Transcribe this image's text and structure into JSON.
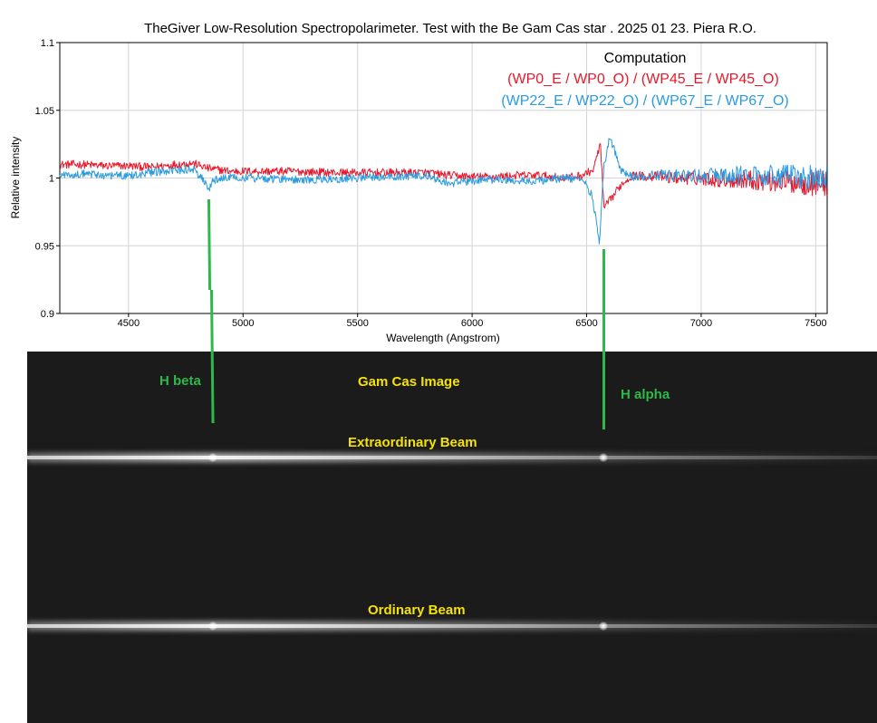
{
  "chart_data": {
    "type": "line",
    "title": "TheGiver Low-Resolution Spectropolarimeter. Test with the Be Gam Cas star . 2025 01 23. Piera R.O.",
    "xlabel": "Wavelength (Angstrom)",
    "ylabel": "Relative intensity",
    "xlim": [
      4200,
      7550
    ],
    "ylim": [
      0.9,
      1.1
    ],
    "x_ticks": [
      4500,
      5000,
      5500,
      6000,
      6500,
      7000,
      7500
    ],
    "y_ticks": [
      0.9,
      0.95,
      1,
      1.05,
      1.1
    ],
    "y_tick_labels": [
      "0.9",
      "0.95",
      "1",
      "1.05",
      "1.1"
    ],
    "legend": {
      "heading": "Computation",
      "placement": "top-right",
      "entries": [
        {
          "text": "(WP0_E / WP0_O) / (WP45_E  / WP45_O)",
          "color": "#e8182a"
        },
        {
          "text": "(WP22_E / WP22_O) / (WP67_E  / WP67_O)",
          "color": "#2a9be0"
        }
      ]
    },
    "series": [
      {
        "color": "#e8182a",
        "x": [
          4200,
          4300,
          4400,
          4500,
          4600,
          4700,
          4780,
          4850,
          4950,
          5050,
          5200,
          5400,
          5600,
          5800,
          5900,
          6000,
          6100,
          6200,
          6300,
          6400,
          6480,
          6530,
          6560,
          6575,
          6600,
          6650,
          6700,
          6800,
          6900,
          7000,
          7100,
          7200,
          7300,
          7400,
          7500,
          7550
        ],
        "y": [
          1.01,
          1.01,
          1.009,
          1.009,
          1.008,
          1.01,
          1.011,
          1.007,
          1.005,
          1.005,
          1.005,
          1.004,
          1.004,
          1.004,
          1.002,
          1.001,
          1.001,
          1.002,
          1.002,
          1.0,
          1.002,
          1.006,
          1.026,
          0.978,
          0.983,
          0.995,
          1.002,
          1.001,
          1.0,
          1.0,
          0.999,
          0.999,
          0.998,
          0.997,
          0.996,
          0.996
        ]
      },
      {
        "color": "#2a9be0",
        "x": [
          4200,
          4300,
          4400,
          4500,
          4600,
          4700,
          4780,
          4830,
          4850,
          4870,
          4950,
          5050,
          5200,
          5400,
          5600,
          5800,
          5900,
          6000,
          6100,
          6200,
          6300,
          6400,
          6480,
          6520,
          6540,
          6555,
          6575,
          6600,
          6650,
          6700,
          6800,
          6900,
          7000,
          7100,
          7200,
          7300,
          7400,
          7500,
          7550
        ],
        "y": [
          1.002,
          1.003,
          1.002,
          1.002,
          1.004,
          1.005,
          1.007,
          0.998,
          0.991,
          0.998,
          1.001,
          1.0,
          0.999,
          0.999,
          1.001,
          1.002,
          0.996,
          0.998,
          0.999,
          0.998,
          0.998,
          1.0,
          0.999,
          0.988,
          0.972,
          0.95,
          1.008,
          1.03,
          1.006,
          1.001,
          1.002,
          1.002,
          1.001,
          1.002,
          1.002,
          1.002,
          1.001,
          1.0,
          1.0
        ]
      }
    ]
  },
  "image_labels": {
    "center": "Gam Cas  Image",
    "h_beta": "H beta",
    "h_alpha": "H alpha",
    "extraordinary": "Extraordinary Beam",
    "ordinary": "Ordinary Beam"
  },
  "colors": {
    "red_series": "#e8182a",
    "blue_series": "#2a9be0",
    "marker_green": "#2fb84a",
    "label_yellow": "#f5e20a",
    "image_background": "#1b1b1b"
  }
}
